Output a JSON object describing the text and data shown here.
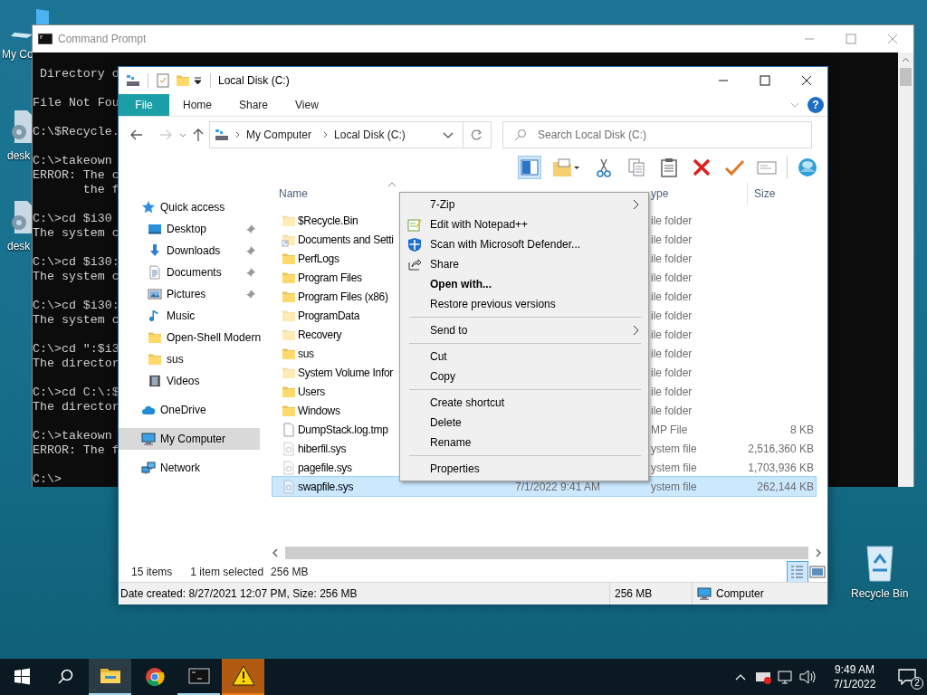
{
  "desktop_icons": [
    {
      "label": "My Co",
      "kind": "computer"
    },
    {
      "label": "desk",
      "kind": "gear"
    },
    {
      "label": "desk",
      "kind": "gear"
    },
    {
      "label": "Recycle Bin",
      "kind": "recycle"
    }
  ],
  "console": {
    "title": "Command Prompt",
    "blocks": [
      [
        " Directory o"
      ],
      [
        "File Not Fou"
      ],
      [
        "C:\\$Recycle."
      ],
      [
        "C:\\>takeown",
        "ERROR: The c",
        "       the f"
      ],
      [
        "C:\\>cd $i30",
        "The system c"
      ],
      [
        "C:\\>cd $i30:",
        "The system c"
      ],
      [
        "C:\\>cd $i30:",
        "The system c"
      ],
      [
        "C:\\>cd \":$i3",
        "The director"
      ],
      [
        "C:\\>cd C:\\:$",
        "The director"
      ],
      [
        "C:\\>takeown",
        "ERROR: The f"
      ],
      [
        "C:\\>"
      ]
    ]
  },
  "explorer": {
    "title": "Local Disk (C:)",
    "ribbon_tabs": [
      {
        "label": "File",
        "kind": "file"
      },
      {
        "label": "Home",
        "kind": "tab"
      },
      {
        "label": "Share",
        "kind": "tab"
      },
      {
        "label": "View",
        "kind": "tab"
      }
    ],
    "help": "?",
    "address": [
      "My Computer",
      "Local Disk (C:)"
    ],
    "search": {
      "placeholder": "Search Local Disk (C:)"
    },
    "toolbar": [
      {
        "kind": "pane",
        "on": true
      },
      {
        "kind": "folder-menu",
        "on": false
      },
      {
        "kind": "cut",
        "on": false
      },
      {
        "kind": "copy",
        "on": false
      },
      {
        "kind": "paste",
        "on": false
      },
      {
        "kind": "delete",
        "on": false
      },
      {
        "kind": "check",
        "on": false
      },
      {
        "kind": "mail",
        "on": false
      },
      {
        "kind": "shell",
        "on": false
      }
    ],
    "nav": [
      {
        "label": "Quick access",
        "kind": "star",
        "selected": false,
        "children": [
          {
            "label": "Desktop",
            "kind": "desktop",
            "pinned": true,
            "selected": false
          },
          {
            "label": "Downloads",
            "kind": "downloads",
            "pinned": true,
            "selected": false
          },
          {
            "label": "Documents",
            "kind": "documents",
            "pinned": true,
            "selected": false
          },
          {
            "label": "Pictures",
            "kind": "pictures",
            "pinned": true,
            "selected": false
          },
          {
            "label": "Music",
            "kind": "music",
            "pinned": false,
            "selected": false
          },
          {
            "label": "Open-Shell Modern",
            "kind": "folder",
            "pinned": false,
            "selected": false
          },
          {
            "label": "sus",
            "kind": "folder",
            "pinned": false,
            "selected": false
          },
          {
            "label": "Videos",
            "kind": "videos",
            "pinned": false,
            "selected": false
          }
        ]
      },
      {
        "label": "OneDrive",
        "kind": "cloud",
        "selected": false
      },
      {
        "label": "My Computer",
        "kind": "computer",
        "selected": true
      },
      {
        "label": "Network",
        "kind": "network",
        "selected": false
      }
    ],
    "columns": [
      {
        "label": "Name",
        "sorted": true
      },
      {
        "label": "ype",
        "sorted": false
      },
      {
        "label": "Size",
        "sorted": false
      }
    ],
    "rows": [
      {
        "name": "$Recycle.Bin",
        "kind": "folder",
        "hidden": true,
        "type": "ile folder",
        "selected": false
      },
      {
        "name": "Documents and Setti",
        "kind": "shortcut",
        "hidden": true,
        "type": "ile folder",
        "selected": false
      },
      {
        "name": "PerfLogs",
        "kind": "folder",
        "hidden": false,
        "type": "ile folder",
        "selected": false
      },
      {
        "name": "Program Files",
        "kind": "folder",
        "hidden": false,
        "type": "ile folder",
        "selected": false
      },
      {
        "name": "Program Files (x86)",
        "kind": "folder",
        "hidden": false,
        "type": "ile folder",
        "selected": false
      },
      {
        "name": "ProgramData",
        "kind": "folder",
        "hidden": true,
        "type": "ile folder",
        "selected": false
      },
      {
        "name": "Recovery",
        "kind": "folder",
        "hidden": true,
        "type": "ile folder",
        "selected": false
      },
      {
        "name": "sus",
        "kind": "folder",
        "hidden": false,
        "type": "ile folder",
        "selected": false
      },
      {
        "name": "System Volume Infor",
        "kind": "folder",
        "hidden": true,
        "type": "ile folder",
        "selected": false
      },
      {
        "name": "Users",
        "kind": "folder",
        "hidden": false,
        "type": "ile folder",
        "selected": false
      },
      {
        "name": "Windows",
        "kind": "folder",
        "hidden": false,
        "type": "ile folder",
        "selected": false
      },
      {
        "name": "DumpStack.log.tmp",
        "kind": "file",
        "hidden": false,
        "type": "MP File",
        "size": "8 KB",
        "selected": false
      },
      {
        "name": "hiberfil.sys",
        "kind": "sysfile",
        "hidden": true,
        "type": "ystem file",
        "size": "2,516,360 KB",
        "selected": false
      },
      {
        "name": "pagefile.sys",
        "kind": "sysfile",
        "hidden": true,
        "type": "ystem file",
        "size": "1,703,936 KB",
        "selected": false
      },
      {
        "name": "swapfile.sys",
        "kind": "sysfile",
        "hidden": true,
        "date": "7/1/2022 9:41 AM",
        "type": "ystem file",
        "size": "262,144 KB",
        "selected": true
      }
    ],
    "context_menu": [
      {
        "kind": "item",
        "label": "7-Zip",
        "submenu": true,
        "default": false
      },
      {
        "kind": "notepad",
        "label": "Edit with Notepad++",
        "submenu": false,
        "default": false
      },
      {
        "kind": "shield",
        "label": "Scan with Microsoft Defender...",
        "submenu": false,
        "default": false
      },
      {
        "kind": "share",
        "label": "Share",
        "submenu": false,
        "default": false
      },
      {
        "kind": "item",
        "label": "Open with...",
        "submenu": false,
        "default": true
      },
      {
        "kind": "item",
        "label": "Restore previous versions",
        "submenu": false,
        "default": false
      },
      {
        "kind": "separator"
      },
      {
        "kind": "item",
        "label": "Send to",
        "submenu": true,
        "default": false
      },
      {
        "kind": "separator"
      },
      {
        "kind": "item",
        "label": "Cut",
        "submenu": false,
        "default": false
      },
      {
        "kind": "item",
        "label": "Copy",
        "submenu": false,
        "default": false
      },
      {
        "kind": "separator"
      },
      {
        "kind": "item",
        "label": "Create shortcut",
        "submenu": false,
        "default": false
      },
      {
        "kind": "item",
        "label": "Delete",
        "submenu": false,
        "default": false
      },
      {
        "kind": "item",
        "label": "Rename",
        "submenu": false,
        "default": false
      },
      {
        "kind": "separator"
      },
      {
        "kind": "item",
        "label": "Properties",
        "submenu": false,
        "default": false
      }
    ],
    "status": {
      "count": "15 items",
      "selection": "1 item selected",
      "size": "256 MB"
    },
    "views": [
      {
        "kind": "details",
        "selected": true
      },
      {
        "kind": "tiles",
        "selected": false
      }
    ],
    "details": {
      "text": "Date created: 8/27/2021 12:07 PM, Size: 256 MB",
      "size": "256 MB",
      "zone": "Computer"
    }
  },
  "taskbar": {
    "apps": [
      {
        "kind": "explorer",
        "selected": true,
        "running": true,
        "alert": false
      },
      {
        "kind": "browser",
        "selected": false,
        "running": false,
        "alert": false
      },
      {
        "kind": "console",
        "selected": false,
        "running": true,
        "alert": false
      },
      {
        "kind": "warning",
        "selected": false,
        "running": false,
        "alert": true
      }
    ],
    "time": "9:49 AM",
    "date": "7/1/2022",
    "notifications": "2"
  }
}
